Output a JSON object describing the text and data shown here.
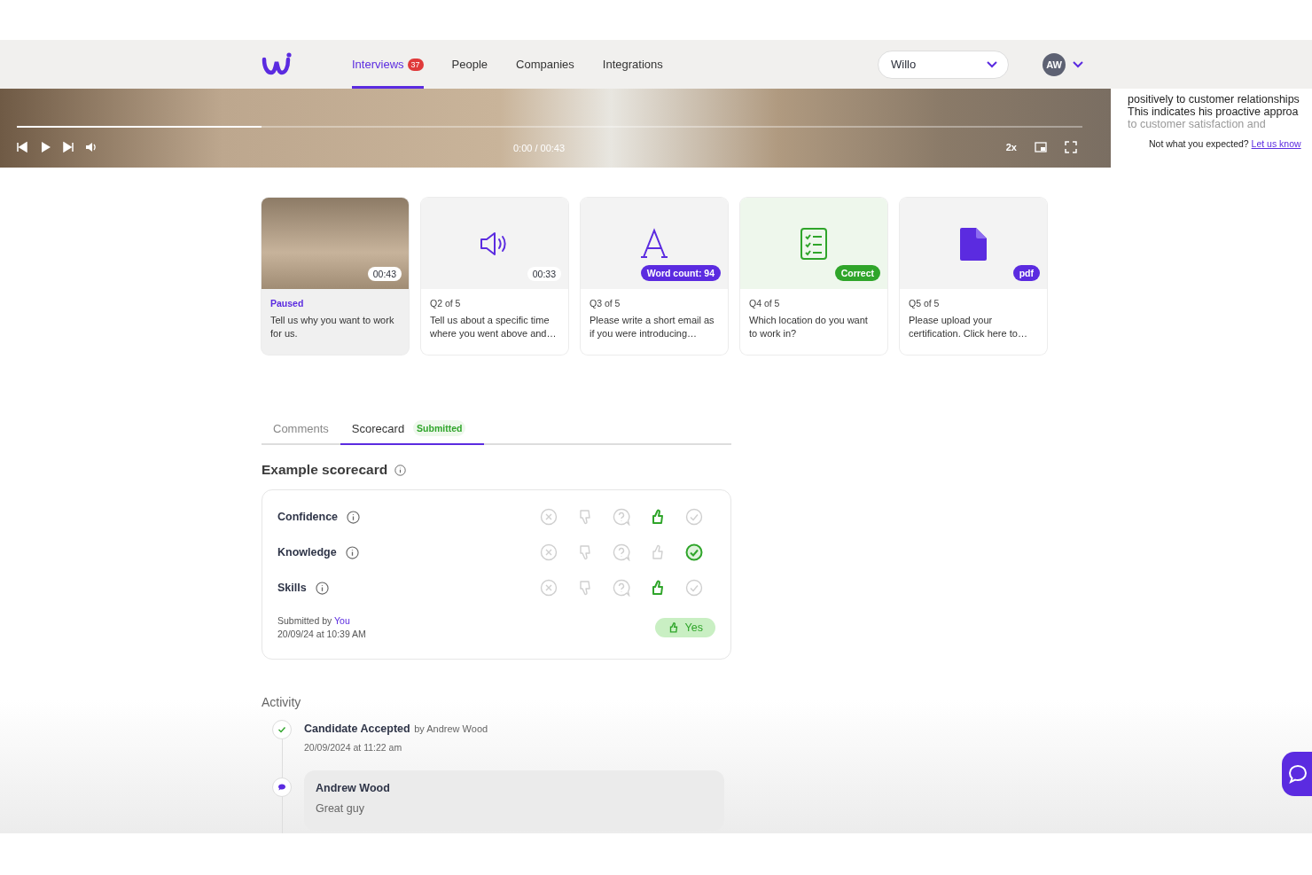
{
  "nav": {
    "tabs": [
      {
        "label": "Interviews",
        "badge": "37",
        "selected": true
      },
      {
        "label": "People",
        "selected": false
      },
      {
        "label": "Companies",
        "selected": false
      },
      {
        "label": "Integrations",
        "selected": false
      }
    ],
    "workspace": {
      "value": "Willo"
    },
    "avatar": {
      "initials": "AW"
    }
  },
  "player": {
    "level": 0.23,
    "time": "0:00 / 00:43",
    "speed": "2x"
  },
  "summary": {
    "lines": [
      "positively to customer relationships",
      "This indicates his proactive approa",
      "to customer satisfaction and"
    ],
    "feedback": "Not what you expected?",
    "feedback_link": "Let us know"
  },
  "questions": [
    {
      "kind": "video",
      "duration": "00:43",
      "status": "Paused",
      "text": "Tell us why you want to work for us.",
      "selected": true
    },
    {
      "kind": "audio",
      "duration": "00:33",
      "label": "Q2 of 5",
      "text": "Tell us about a specific time where you went above and…",
      "selected": false
    },
    {
      "kind": "text",
      "badge": "Word count: 94",
      "label": "Q3 of 5",
      "text": "Please write a short email as if you were introducing…",
      "selected": false
    },
    {
      "kind": "choice",
      "badge": "Correct",
      "label": "Q4 of 5",
      "text": "Which location do you want to work in?",
      "selected": false
    },
    {
      "kind": "file",
      "badge": "pdf",
      "label": "Q5 of 5",
      "text": "Please upload your certification. Click here to…",
      "selected": false
    }
  ],
  "tabs": [
    {
      "label": "Comments",
      "selected": false
    },
    {
      "label": "Scorecard",
      "badge": "Submitted",
      "selected": true
    }
  ],
  "scorecard": {
    "title": "Example scorecard",
    "criteria": [
      {
        "name": "Confidence",
        "options": [
          {
            "kind": "no",
            "selected": false
          },
          {
            "kind": "thumbs-down",
            "selected": false
          },
          {
            "kind": "unsure",
            "selected": false
          },
          {
            "kind": "thumbs-up",
            "selected": true
          },
          {
            "kind": "yes",
            "selected": false
          }
        ]
      },
      {
        "name": "Knowledge",
        "options": [
          {
            "kind": "no",
            "selected": false
          },
          {
            "kind": "thumbs-down",
            "selected": false
          },
          {
            "kind": "unsure",
            "selected": false
          },
          {
            "kind": "thumbs-up",
            "selected": false
          },
          {
            "kind": "yes",
            "selected": true
          }
        ]
      },
      {
        "name": "Skills",
        "options": [
          {
            "kind": "no",
            "selected": false
          },
          {
            "kind": "thumbs-down",
            "selected": false
          },
          {
            "kind": "unsure",
            "selected": false
          },
          {
            "kind": "thumbs-up",
            "selected": true
          },
          {
            "kind": "yes",
            "selected": false
          }
        ]
      }
    ],
    "submitted_by": "Submitted by",
    "submitter": "You",
    "submitted_at": "20/09/24 at 10:39 AM",
    "verdict": "Yes"
  },
  "activity": {
    "title": "Activity",
    "events": [
      {
        "kind": "status",
        "title": "Candidate Accepted",
        "by": "by Andrew Wood",
        "time": "20/09/2024 at 11:22 am"
      },
      {
        "kind": "comment",
        "author": "Andrew Wood",
        "text": "Great guy"
      }
    ]
  }
}
